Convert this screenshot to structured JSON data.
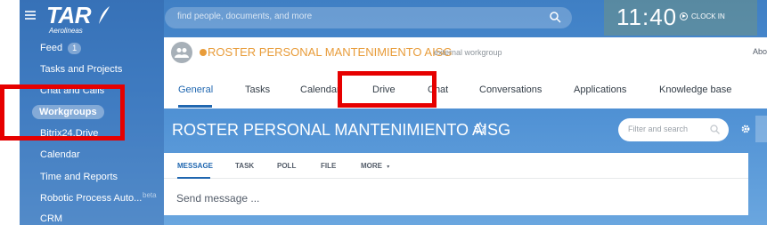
{
  "brand": {
    "name": "TAR",
    "tagline": "Aerolineas"
  },
  "search": {
    "placeholder": "find people, documents, and more"
  },
  "clock": {
    "time": "11:40",
    "action": "CLOCK IN"
  },
  "sidebar": {
    "items": [
      {
        "label": "Feed",
        "counter": "1"
      },
      {
        "label": "Tasks and Projects"
      },
      {
        "label": "Chat and Calls"
      },
      {
        "label": "Workgroups",
        "active": true
      },
      {
        "label": "Bitrix24.Drive"
      },
      {
        "label": "Calendar"
      },
      {
        "label": "Time and Reports"
      },
      {
        "label": "Robotic Process Auto...",
        "badge": "beta"
      },
      {
        "label": "CRM"
      }
    ]
  },
  "group": {
    "title": "ROSTER PERSONAL MANTENIMIENTO AISG",
    "subtitle": "external workgroup",
    "about": "Abo"
  },
  "tabs": [
    "General",
    "Tasks",
    "Calendar",
    "Drive",
    "Chat",
    "Conversations",
    "Applications",
    "Knowledge base"
  ],
  "page_title": "ROSTER PERSONAL MANTENIMIENTO AISG",
  "filter": {
    "placeholder": "Filter and search"
  },
  "composer": {
    "tabs": [
      "MESSAGE",
      "TASK",
      "POLL",
      "FILE",
      "MORE"
    ],
    "placeholder": "Send message ..."
  },
  "colors": {
    "accent": "#2067b0",
    "group_title": "#e89c3a",
    "highlight": "#e60000"
  }
}
